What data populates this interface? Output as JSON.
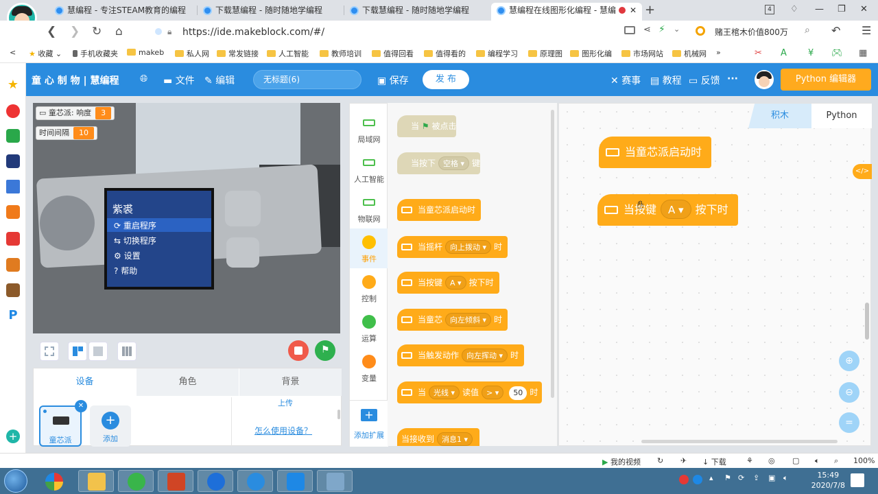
{
  "browser": {
    "tabs": [
      {
        "title": "慧编程 - 专注STEAM教育的编程"
      },
      {
        "title": "下载慧编程 - 随时随地学编程"
      },
      {
        "title": "下载慧编程 - 随时随地学编程"
      },
      {
        "title": "慧编程在线图形化编程 - 慧编"
      }
    ],
    "tab_count": "4",
    "url": "https://ide.makeblock.com/#/",
    "search_hint": "赌王棺木价值800万",
    "bookmarks": [
      "收藏",
      "手机收藏夹",
      "makeb",
      "私人网",
      "常发链接",
      "人工智能",
      "教师培训",
      "值得回看",
      "值得看的",
      "编程学习",
      "原理图",
      "图形化编",
      "市场网站",
      "机械网"
    ]
  },
  "app": {
    "brand": "童 心 制 物 | 慧编程",
    "menu_file": "文件",
    "menu_edit": "编辑",
    "project_title": "无标题(6)",
    "save": "保存",
    "publish": "发 布",
    "events": "赛事",
    "tutorials": "教程",
    "feedback": "反馈",
    "more": "···",
    "python_editor": "Python 编辑器"
  },
  "stage": {
    "var1_label": "童芯派: 响度",
    "var1_value": "3",
    "var2_label": "时间间隔",
    "var2_value": "10",
    "screen_title": "紫裘",
    "screen_items": [
      "重启程序",
      "切换程序",
      "设置",
      "帮助"
    ]
  },
  "device_panel": {
    "tabs": [
      "设备",
      "角色",
      "背景"
    ],
    "upload": "上传",
    "device_name": "童芯派",
    "add": "添加",
    "help_link": "怎么使用设备？"
  },
  "categories": [
    {
      "label": "局域网",
      "color": "#4cbf4c",
      "icon": "device-icon"
    },
    {
      "label": "人工智能",
      "color": "#4cbf4c",
      "icon": "device-icon"
    },
    {
      "label": "物联网",
      "color": "#4cbf4c",
      "icon": "device-icon"
    },
    {
      "label": "事件",
      "color": "#ffbf00",
      "icon": "dot-icon"
    },
    {
      "label": "控制",
      "color": "#ffab19",
      "icon": "dot-icon"
    },
    {
      "label": "运算",
      "color": "#40bf4a",
      "icon": "dot-icon"
    },
    {
      "label": "变量",
      "color": "#ff8c1a",
      "icon": "dot-icon"
    }
  ],
  "add_extension": "添加扩展",
  "palette": {
    "b1": {
      "pre": "当",
      "post": "被点击"
    },
    "b2": {
      "pre": "当按下",
      "dd": "空格",
      "post": "键"
    },
    "b3": {
      "pre": "当童芯派启动时"
    },
    "b4": {
      "pre": "当摇杆",
      "dd": "向上拨动",
      "post": "时"
    },
    "b5": {
      "pre": "当按键",
      "dd": "A",
      "post": "按下时"
    },
    "b6": {
      "pre": "当童芯",
      "dd": "向左倾斜",
      "post": "时"
    },
    "b7": {
      "pre": "当触发动作",
      "dd": "向左挥动",
      "post": "时"
    },
    "b8": {
      "pre": "当",
      "dd": "光线",
      "mid": "读值",
      "dd2": ">",
      "num": "50",
      "post": "时"
    },
    "b9": {
      "pre": "当接收到",
      "dd": "消息1"
    }
  },
  "workspace": {
    "tab_blocks": "积木",
    "tab_python": "Python",
    "block1": "当童芯派启动时",
    "block2_pre": "当按键",
    "block2_dd": "A",
    "block2_post": "按下时"
  },
  "statusbar": {
    "video": "我的视频",
    "download": "下载",
    "zoom": "100%"
  },
  "taskbar": {
    "time": "15:49",
    "date": "2020/7/8"
  }
}
